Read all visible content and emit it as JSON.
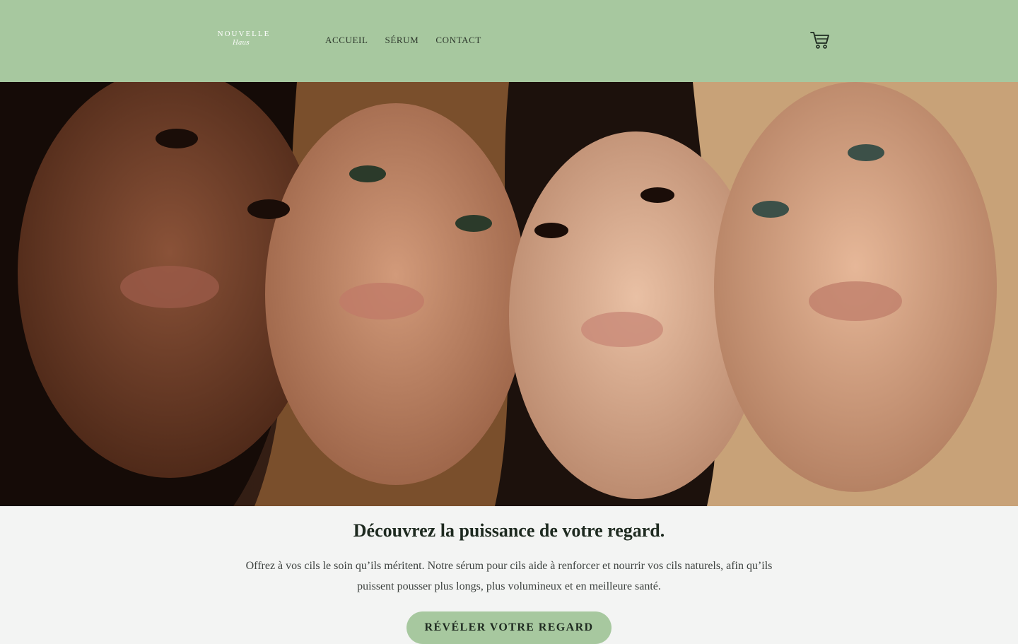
{
  "brand": {
    "line1": "NOUVELLE",
    "line2": "Haus"
  },
  "nav": {
    "items": [
      {
        "label": "ACCUEIL"
      },
      {
        "label": "SÉRUM"
      },
      {
        "label": "CONTACT"
      }
    ]
  },
  "header": {
    "cart_icon": "shopping-cart-icon",
    "background": "#a7c89f"
  },
  "hero": {
    "image_alt": "four women with long eyelashes",
    "background": "#3a2218"
  },
  "content": {
    "headline": "Découvrez la puissance de votre regard.",
    "body": "Offrez à vos cils le soin qu’ils méritent. Notre sérum pour cils aide à renforcer et nourrir vos cils naturels, afin qu’ils puissent pousser plus longs, plus volumineux et en meilleure santé.",
    "cta_label": "RÉVÉLER VOTRE REGARD"
  },
  "colors": {
    "accent": "#a7c89f",
    "text_dark": "#1e2a20",
    "page_bg": "#f3f4f3"
  }
}
